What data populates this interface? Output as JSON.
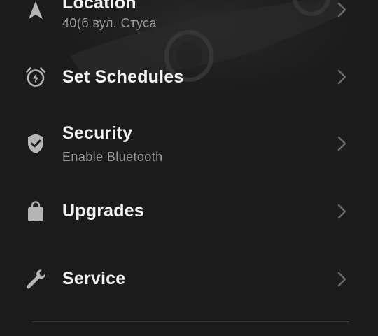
{
  "colors": {
    "background": "#1b1b1b",
    "label": "#f2f2f2",
    "sublabel": "#9a9a9a",
    "icon": "#b5b5b5",
    "chevron": "#6a6a6a"
  },
  "menu": {
    "items": [
      {
        "id": "location",
        "icon": "navigation-arrow-icon",
        "label": "Location",
        "sub": "40(б вул. Стуса"
      },
      {
        "id": "schedules",
        "icon": "alarm-clock-bolt-icon",
        "label": "Set Schedules",
        "sub": ""
      },
      {
        "id": "security",
        "icon": "shield-check-icon",
        "label": "Security",
        "sub": "Enable Bluetooth"
      },
      {
        "id": "upgrades",
        "icon": "shopping-bag-icon",
        "label": "Upgrades",
        "sub": ""
      },
      {
        "id": "service",
        "icon": "wrench-icon",
        "label": "Service",
        "sub": ""
      }
    ]
  }
}
